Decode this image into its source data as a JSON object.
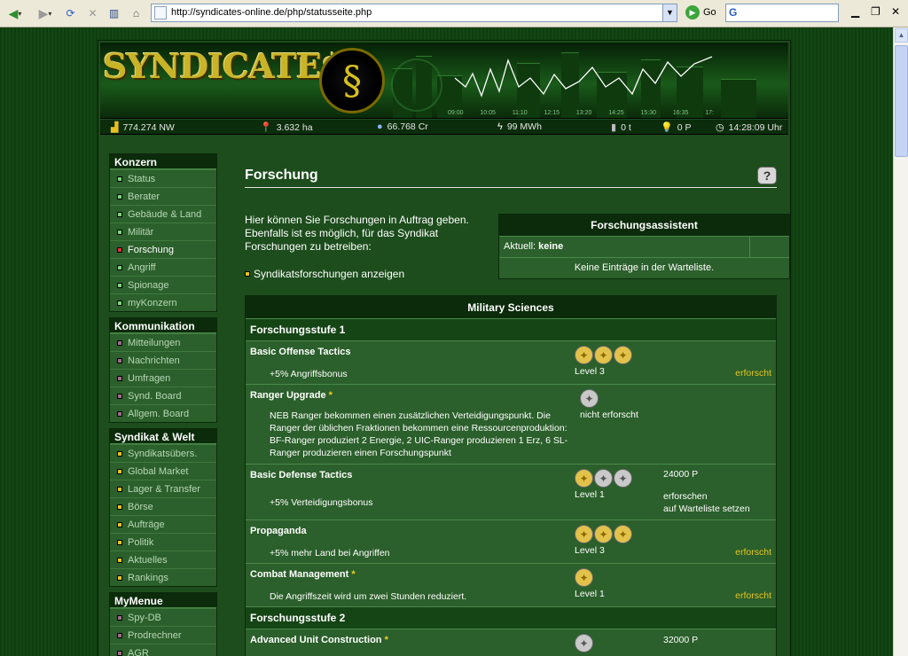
{
  "browser": {
    "url": "http://syndicates-online.de/php/statusseite.php",
    "go_label": "Go",
    "search_logo": "G"
  },
  "banner": {
    "logo_text": "SYNDICATE$",
    "ticker_times": [
      "09:00",
      "10:05",
      "11:10",
      "12:15",
      "13:20",
      "14:25",
      "15:30",
      "16:35",
      "17:"
    ]
  },
  "stats": {
    "networth": "774.274 NW",
    "land": "3.632 ha",
    "credits": "66.768 Cr",
    "energy": "99 MWh",
    "ore": "0 t",
    "research_points": "0 P",
    "time": "14:28:09 Uhr"
  },
  "sidebar": {
    "sections": [
      {
        "title": "Konzern",
        "items": [
          {
            "label": "Status",
            "color": "#7ed07e"
          },
          {
            "label": "Berater",
            "color": "#7ed07e"
          },
          {
            "label": "Gebäude & Land",
            "color": "#7ed07e"
          },
          {
            "label": "Militär",
            "color": "#7ed07e"
          },
          {
            "label": "Forschung",
            "color": "#e03030"
          },
          {
            "label": "Angriff",
            "color": "#7ed07e"
          },
          {
            "label": "Spionage",
            "color": "#7ed07e"
          },
          {
            "label": "myKonzern",
            "color": "#7ed07e"
          }
        ]
      },
      {
        "title": "Kommunikation",
        "items": [
          {
            "label": "Mitteilungen",
            "color": "#a06a8a"
          },
          {
            "label": "Nachrichten",
            "color": "#a06a8a"
          },
          {
            "label": "Umfragen",
            "color": "#a06a8a"
          },
          {
            "label": "Synd. Board",
            "color": "#a06a8a"
          },
          {
            "label": "Allgem. Board",
            "color": "#a06a8a"
          }
        ]
      },
      {
        "title": "Syndikat & Welt",
        "items": [
          {
            "label": "Syndikatsübers.",
            "color": "#e8c020"
          },
          {
            "label": "Global Market",
            "color": "#e8c020"
          },
          {
            "label": "Lager & Transfer",
            "color": "#e8c020"
          },
          {
            "label": "Börse",
            "color": "#e8c020"
          },
          {
            "label": "Aufträge",
            "color": "#e8c020"
          },
          {
            "label": "Politik",
            "color": "#e8c020"
          },
          {
            "label": "Aktuelles",
            "color": "#e8c020"
          },
          {
            "label": "Rankings",
            "color": "#e8c020"
          }
        ]
      },
      {
        "title": "MyMenue",
        "items": [
          {
            "label": "Spy-DB",
            "color": "#a06a8a"
          },
          {
            "label": "Prodrechner",
            "color": "#a06a8a"
          },
          {
            "label": "AGR",
            "color": "#a06a8a"
          }
        ]
      }
    ]
  },
  "main": {
    "title": "Forschung",
    "help_label": "?",
    "intro": "Hier können Sie Forschungen in Auftrag geben. Ebenfalls ist es möglich, für das Syndikat Forschungen zu betreiben:",
    "synd_link": "Syndikatsforschungen anzeigen",
    "assistant": {
      "title": "Forschungsassistent",
      "current_label": "Aktuell:",
      "current_value": "keine",
      "empty": "Keine Einträge in der Warteliste."
    },
    "research": {
      "category": "Military Sciences",
      "stufe1": "Forschungsstufe 1",
      "stufe2": "Forschungsstufe 2",
      "items": [
        {
          "name": "Basic Offense Tactics",
          "star": "",
          "desc": "+5% Angriffsbonus",
          "level": "Level 3",
          "status": "erforscht"
        },
        {
          "name": "Ranger Upgrade",
          "star": "*",
          "desc": "NEB Ranger bekommen einen zusätzlichen Verteidigungspunkt. Die Ranger der üblichen Fraktionen bekommen eine Ressourcenproduktion: BF-Ranger produziert 2 Energie, 2 UIC-Ranger produzieren 1 Erz, 6 SL-Ranger produzieren einen Forschungspunkt",
          "level": "nicht erforscht",
          "status": ""
        },
        {
          "name": "Basic Defense Tactics",
          "star": "",
          "desc": "+5% Verteidigungsbonus",
          "level": "Level 1",
          "cost": "24000 P",
          "action1": "erforschen",
          "action2": "auf Warteliste setzen"
        },
        {
          "name": "Propaganda",
          "star": "",
          "desc": "+5% mehr Land bei Angriffen",
          "level": "Level 3",
          "status": "erforscht"
        },
        {
          "name": "Combat Management",
          "star": "*",
          "desc": "Die Angriffszeit wird um zwei Stunden reduziert.",
          "level": "Level 1",
          "status": "erforscht"
        },
        {
          "name": "Advanced Unit Construction",
          "star": "*",
          "cost": "32000 P"
        }
      ]
    }
  }
}
